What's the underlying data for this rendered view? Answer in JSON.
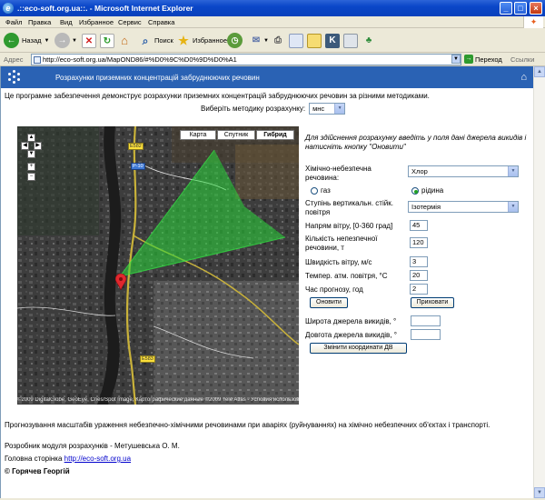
{
  "window": {
    "title": ".::eco-soft.org.ua::. - Microsoft Internet Explorer"
  },
  "menu": [
    "Файл",
    "Правка",
    "Вид",
    "Избранное",
    "Сервис",
    "Справка"
  ],
  "toolbar": {
    "back": "Назад",
    "search": "Поиск",
    "favorites": "Избранное"
  },
  "address": {
    "label": "Адрес",
    "url": "http://eco-soft.org.ua/MapOND86/#%D0%9C%D0%9D%D0%A1",
    "go": "Переход",
    "links": "Ссылки"
  },
  "banner": {
    "title": "Розрахунки приземних концентрацій забруднюючих речовин"
  },
  "intro": "Це програмне забезпечення демонструє розрахунки приземних концентрацій забруднюючих речовин за різними методиками.",
  "method": {
    "label": "Виберіть методику розрахунку:",
    "value": "мнс"
  },
  "map": {
    "types": [
      "Карта",
      "Спутник",
      "Гибрид"
    ],
    "active_type": "Гибрид",
    "roads": [
      "E582",
      "P-10",
      "E583"
    ],
    "attribution": "©2009 DigitalGlobe, GeoEye, Cnes/Spot Image, Картографические данные ©2009 Tele Atlas - Условия использования"
  },
  "form": {
    "note": "Для здійснення розрахунку введіть у поля дані джерела викидів і натисніть кнопку \"Оновити\"",
    "substance": {
      "label": "Хімічно-небезпечна речовина:",
      "value": "Хлор"
    },
    "state": {
      "gas": "газ",
      "liquid": "рідина",
      "selected": "liquid"
    },
    "stability": {
      "label": "Ступінь вертикальн. стійк. повітря",
      "value": "Ізотермія"
    },
    "wind_dir": {
      "label": "Напрям вітру, [0-360 град]",
      "value": "45"
    },
    "amount": {
      "label": "Кількість непезпечної речовини, т",
      "value": "120"
    },
    "wind_speed": {
      "label": "Швидкість вітру, м/с",
      "value": "3"
    },
    "temperature": {
      "label": "Темпер. атм. повітря, °С",
      "value": "20"
    },
    "forecast": {
      "label": "Час прогнозу, год",
      "value": "2"
    },
    "update_btn": "Оновити",
    "hide_btn": "Приховати",
    "latitude": {
      "label": "Широта джерела викидів, °",
      "value": ""
    },
    "longitude": {
      "label": "Довгота джерела викидів, °",
      "value": ""
    },
    "change_coords_btn": "Змінити координати ДВ"
  },
  "footer": {
    "forecast_text": "Прогнозування масштабів ураження небезпечно-хімічними речовинами при аваріях (руйнуваннях) на хімічно небезпечних об'єктах і транспорті.",
    "developer": "Розробник модуля розрахунків - Метушевська О. М.",
    "homepage_label": "Головна сторінка",
    "homepage_url": "http://eco-soft.org.ua",
    "copyright": "© Горячев Георгій"
  },
  "colors": {
    "banner": "#2a62b4",
    "plume": "#29d93a",
    "titlebar": "#0a46c8"
  }
}
